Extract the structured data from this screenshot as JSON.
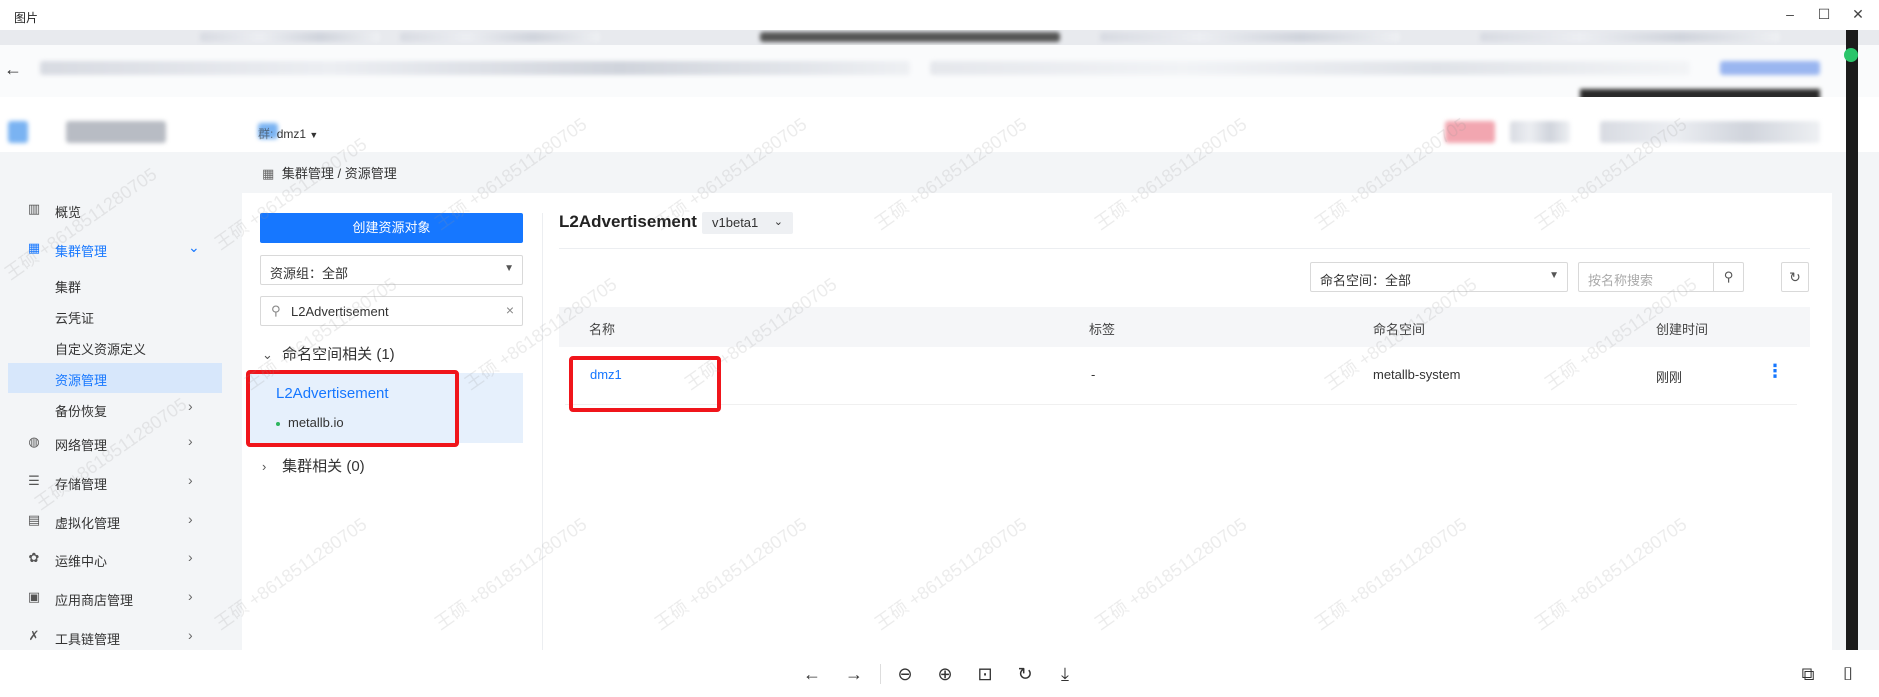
{
  "viewer": {
    "title": "图片",
    "controls": {
      "minimize": "–",
      "maximize": "☐",
      "close": "✕"
    },
    "toolbar_icons": [
      "arrow-left-icon",
      "arrow-right-icon",
      "zoom-out-icon",
      "zoom-in-icon",
      "fit-icon",
      "rotate-icon",
      "download-icon"
    ]
  },
  "app": {
    "cluster_selector": {
      "prefix": "群:",
      "value": "dmz1"
    },
    "breadcrumb": "集群管理 / 资源管理"
  },
  "sidebar": {
    "items": [
      {
        "label": "概览",
        "icon": "chart-icon"
      },
      {
        "label": "集群管理",
        "icon": "cluster-icon",
        "expanded": true,
        "children": [
          "集群",
          "云凭证",
          "自定义资源定义",
          "资源管理",
          "备份恢复"
        ]
      },
      {
        "label": "网络管理",
        "icon": "globe-icon"
      },
      {
        "label": "存储管理",
        "icon": "database-icon"
      },
      {
        "label": "虚拟化管理",
        "icon": "vm-icon"
      },
      {
        "label": "运维中心",
        "icon": "ops-icon"
      },
      {
        "label": "应用商店管理",
        "icon": "store-icon"
      },
      {
        "label": "工具链管理",
        "icon": "tools-icon"
      }
    ],
    "active": "资源管理"
  },
  "left_panel": {
    "create_button": "创建资源对象",
    "resource_group_select": "资源组：全部",
    "search_value": "L2Advertisement",
    "groups": [
      {
        "label": "命名空间相关 (1)",
        "expanded": true,
        "items": [
          {
            "name": "L2Advertisement",
            "api_group": "metallb.io"
          }
        ]
      },
      {
        "label": "集群相关 (0)",
        "expanded": false
      }
    ]
  },
  "right_panel": {
    "resource_title": "L2Advertisement",
    "version": "v1beta1",
    "namespace_select": "命名空间：全部",
    "name_search_placeholder": "按名称搜索",
    "columns": [
      "名称",
      "标签",
      "命名空间",
      "创建时间"
    ],
    "rows": [
      {
        "name": "dmz1",
        "labels": "-",
        "namespace": "metallb-system",
        "created": "刚刚"
      }
    ]
  },
  "colors": {
    "primary": "#1677ff",
    "highlight_box": "#f0151b",
    "active_bg": "#d7e7fb"
  }
}
